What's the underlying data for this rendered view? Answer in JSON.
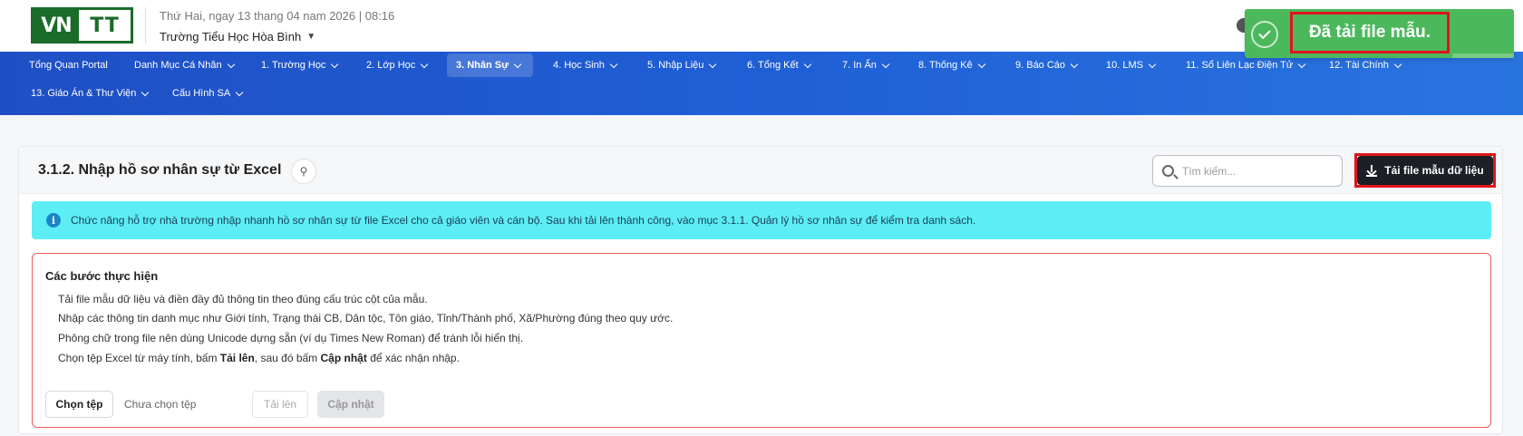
{
  "header": {
    "logo": {
      "left": "VN",
      "right": "TT"
    },
    "date": "Thứ Hai, ngay 13 thang 04 nam 2026 | 08:16",
    "school": "Trường Tiểu Học Hòa Bình"
  },
  "nav": {
    "row1": [
      {
        "label": "Tổng Quan Portal",
        "dropdown": false
      },
      {
        "label": "Danh Mục Cá Nhân",
        "dropdown": true
      },
      {
        "label": "1. Trường Học",
        "dropdown": true
      },
      {
        "label": "2. Lớp Học",
        "dropdown": true
      },
      {
        "label": "3. Nhân Sự",
        "dropdown": true,
        "active": true
      },
      {
        "label": "4. Học Sinh",
        "dropdown": true
      },
      {
        "label": "5. Nhập Liệu",
        "dropdown": true
      },
      {
        "label": "6. Tổng Kết",
        "dropdown": true
      },
      {
        "label": "7. In Ấn",
        "dropdown": true
      },
      {
        "label": "8. Thống Kê",
        "dropdown": true
      },
      {
        "label": "9. Báo Cáo",
        "dropdown": true
      },
      {
        "label": "10. LMS",
        "dropdown": true
      },
      {
        "label": "11. Sổ Liên Lạc Điện Tử",
        "dropdown": true
      },
      {
        "label": "12. Tài Chính",
        "dropdown": true
      }
    ],
    "row2": [
      {
        "label": "13. Giáo Án & Thư Viện",
        "dropdown": true
      },
      {
        "label": "Cấu Hình SA",
        "dropdown": true
      }
    ]
  },
  "toast": {
    "message": "Đã tải file mẫu.",
    "color": "#4cb85c"
  },
  "page": {
    "title": "3.1.2. Nhập hồ sơ nhân sự từ Excel",
    "search_placeholder": "Tìm kiếm...",
    "download_button": "Tải file mẫu dữ liệu",
    "info": "Chức năng hỗ trợ nhà trường nhập nhanh hồ sơ nhân sự từ file Excel cho cả giáo viên và cán bộ. Sau khi tải lên thành công, vào mục 3.1.1. Quản lý hồ sơ nhân sự để kiểm tra danh sách."
  },
  "steps": {
    "title": "Các bước thực hiện",
    "items": [
      "Tải file mẫu dữ liệu và điền đầy đủ thông tin theo đúng cấu trúc cột của mẫu.",
      "Nhập các thông tin danh mục như Giới tính, Trạng thái CB, Dân tộc, Tôn giáo, Tỉnh/Thành phố, Xã/Phường đúng theo quy ước.",
      "Phông chữ trong file nên dùng Unicode dựng sẵn (ví dụ Times New Roman) để tránh lỗi hiển thị."
    ],
    "last": {
      "prefix": "Chọn tệp Excel từ máy tính, bấm ",
      "upload_word": "Tải lên",
      "middle": ", sau đó bấm ",
      "update_word": "Cập nhật",
      "suffix": " để xác nhận nhập."
    },
    "choose_button": "Chọn tệp",
    "no_file": "Chưa chọn tệp",
    "upload_button": "Tải lên",
    "update_button": "Cập nhật"
  }
}
